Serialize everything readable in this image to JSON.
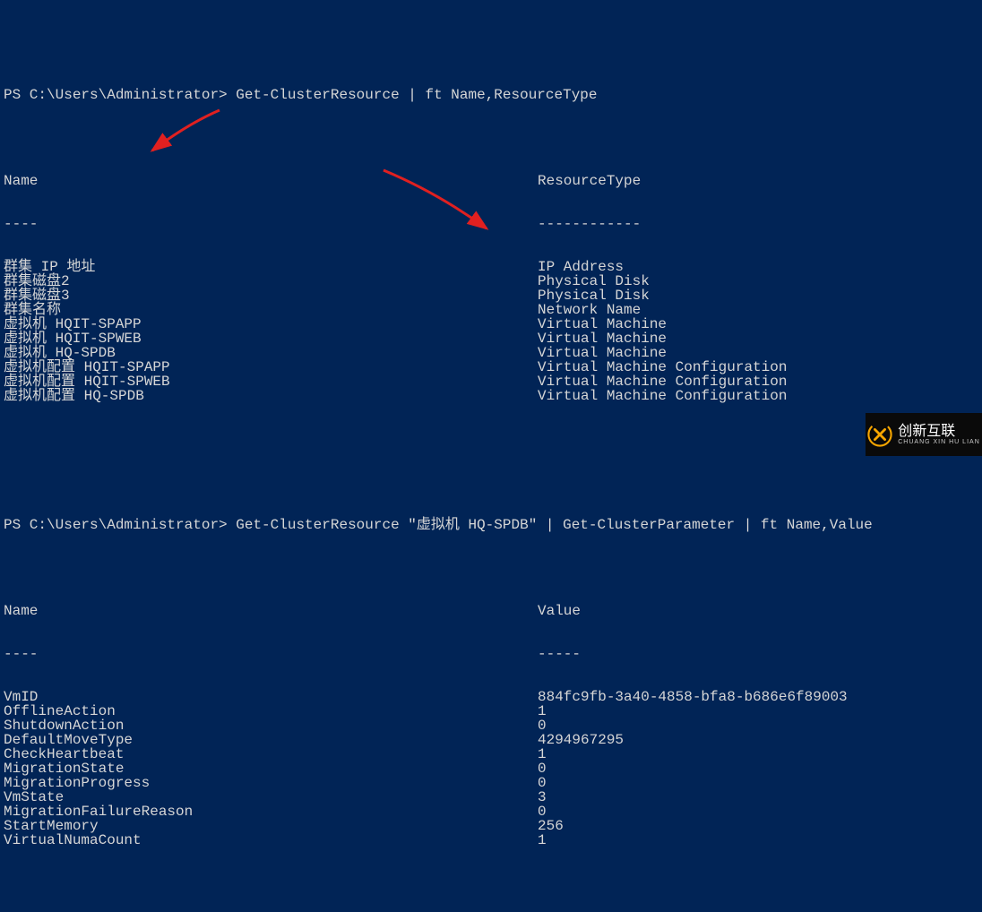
{
  "prompt1": "PS C:\\Users\\Administrator> Get-ClusterResource | ft Name,ResourceType",
  "table1": {
    "h1": "Name",
    "h2": "ResourceType",
    "d1": "----",
    "d2": "------------",
    "rows": [
      {
        "name": "群集 IP 地址",
        "type": "IP Address"
      },
      {
        "name": "群集磁盘2",
        "type": "Physical Disk"
      },
      {
        "name": "群集磁盘3",
        "type": "Physical Disk"
      },
      {
        "name": "群集名称",
        "type": "Network Name"
      },
      {
        "name": "虚拟机 HQIT-SPAPP",
        "type": "Virtual Machine"
      },
      {
        "name": "虚拟机 HQIT-SPWEB",
        "type": "Virtual Machine"
      },
      {
        "name": "虚拟机 HQ-SPDB",
        "type": "Virtual Machine"
      },
      {
        "name": "虚拟机配置 HQIT-SPAPP",
        "type": "Virtual Machine Configuration"
      },
      {
        "name": "虚拟机配置 HQIT-SPWEB",
        "type": "Virtual Machine Configuration"
      },
      {
        "name": "虚拟机配置 HQ-SPDB",
        "type": "Virtual Machine Configuration"
      }
    ]
  },
  "prompt2": "PS C:\\Users\\Administrator> Get-ClusterResource \"虚拟机 HQ-SPDB\" | Get-ClusterParameter | ft Name,Value",
  "table2": {
    "h1": "Name",
    "h2": "Value",
    "d1": "----",
    "d2": "-----",
    "rows": [
      {
        "name": "VmID",
        "value": "884fc9fb-3a40-4858-bfa8-b686e6f89003"
      },
      {
        "name": "OfflineAction",
        "value": "1"
      },
      {
        "name": "ShutdownAction",
        "value": "0"
      },
      {
        "name": "DefaultMoveType",
        "value": "4294967295"
      },
      {
        "name": "CheckHeartbeat",
        "value": "1"
      },
      {
        "name": "MigrationState",
        "value": "0"
      },
      {
        "name": "MigrationProgress",
        "value": "0"
      },
      {
        "name": "VmState",
        "value": "3"
      },
      {
        "name": "MigrationFailureReason",
        "value": "0"
      },
      {
        "name": "StartMemory",
        "value": "256"
      },
      {
        "name": "VirtualNumaCount",
        "value": "1"
      }
    ]
  },
  "watermark": {
    "main": "创新互联",
    "sub": "CHUANG XIN HU LIAN"
  }
}
